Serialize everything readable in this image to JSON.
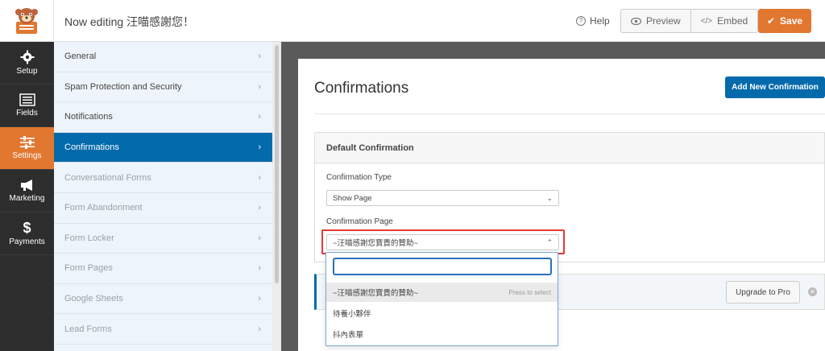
{
  "topbar": {
    "editing_title": "Now editing 汪喵感謝您！",
    "help_label": "Help",
    "preview_label": "Preview",
    "embed_label": "Embed",
    "save_label": "Save"
  },
  "leftnav": {
    "items": [
      {
        "label": "Setup",
        "icon": "gear-icon"
      },
      {
        "label": "Fields",
        "icon": "fields-icon"
      },
      {
        "label": "Settings",
        "icon": "sliders-icon",
        "active": true
      },
      {
        "label": "Marketing",
        "icon": "megaphone-icon"
      },
      {
        "label": "Payments",
        "icon": "dollar-icon"
      }
    ]
  },
  "settings_panel": {
    "items": [
      {
        "label": "General"
      },
      {
        "label": "Spam Protection and Security"
      },
      {
        "label": "Notifications"
      },
      {
        "label": "Confirmations",
        "active": true
      },
      {
        "label": "Conversational Forms",
        "dim": true
      },
      {
        "label": "Form Abandonment",
        "dim": true
      },
      {
        "label": "Form Locker",
        "dim": true
      },
      {
        "label": "Form Pages",
        "dim": true
      },
      {
        "label": "Google Sheets",
        "dim": true
      },
      {
        "label": "Lead Forms",
        "dim": true
      }
    ]
  },
  "main": {
    "page_title": "Confirmations",
    "add_button": "Add New Confirmation",
    "card_title": "Default Confirmation",
    "confirmation_type_label": "Confirmation Type",
    "confirmation_type_value": "Show Page",
    "confirmation_page_label": "Confirmation Page",
    "confirmation_page_value": "~汪喵感謝您寶貴的贊助~",
    "upgrade_label": "Upgrade to Pro"
  },
  "dropdown": {
    "search_value": "",
    "press_hint": "Press to select",
    "options": [
      "~汪喵感謝您寶貴的贊助~",
      "待養小夥伴",
      "抖內表單"
    ]
  },
  "colors": {
    "accent_orange": "#e27730",
    "primary_blue": "#036aab",
    "nav_dark": "#2d2d2d",
    "panel_bg": "#eef4fb",
    "highlight_red": "#e53935"
  }
}
